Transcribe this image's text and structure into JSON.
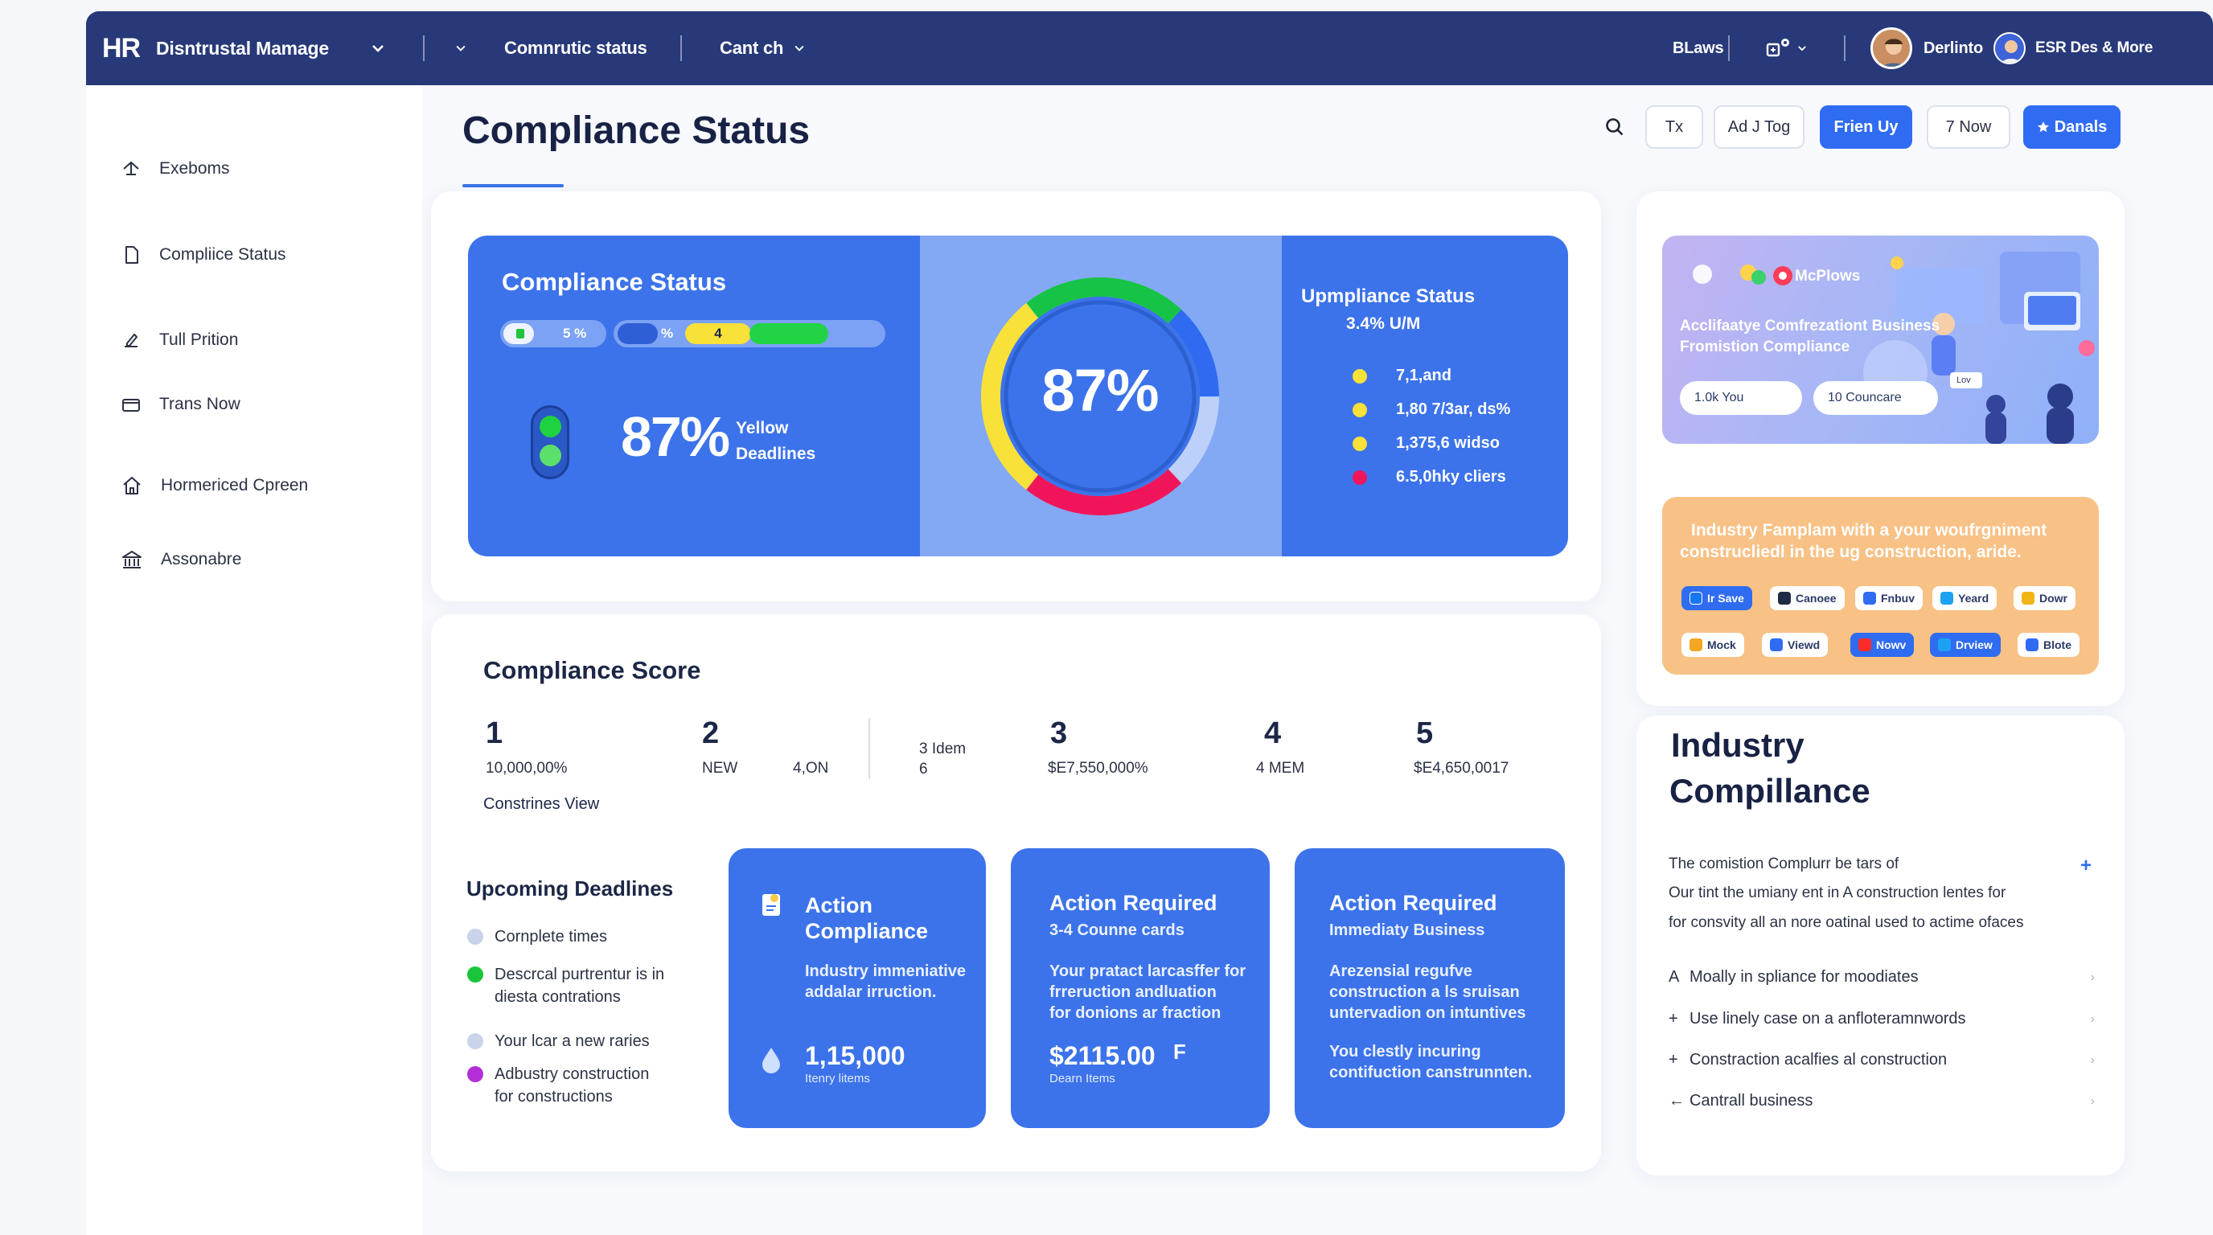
{
  "topbar": {
    "logo": "HR",
    "app_name": "Disntrustal Mamage",
    "nav1": "Comnrutic status",
    "nav2": "Cant ch",
    "blaws": "BLaws",
    "user1": "Derlinto",
    "user2": "ESR Des & More"
  },
  "sidebar": {
    "items": [
      {
        "label": "Exeboms",
        "icon": "upload-icon"
      },
      {
        "label": "Compliice Status",
        "icon": "document-icon"
      },
      {
        "label": "Tull Prition",
        "icon": "edit-icon"
      },
      {
        "label": "Trans Now",
        "icon": "folder-icon"
      },
      {
        "label": "Hormericed Cpreen",
        "icon": "home-icon"
      },
      {
        "label": "Assonabre",
        "icon": "bank-icon"
      }
    ]
  },
  "header": {
    "title": "Compliance Status",
    "buttons": [
      "Tx",
      "Ad J Tog",
      "Frien Uy",
      "7 Now",
      "Danals"
    ]
  },
  "hero": {
    "left_title": "Compliance Status",
    "pill1": "5 %",
    "pill2a": "%",
    "pill2b": "4",
    "big_pct": "87%",
    "big_label1": "Yellow",
    "big_label2": "Deadlines",
    "donut_value": "87%",
    "donut_fraction": 0.87,
    "right_title": "Upmpliance Status",
    "right_sub": "3.4% U/M",
    "legend": [
      {
        "label": "7,1,and",
        "color": "#f8e139"
      },
      {
        "label": "1,80 7/3ar, ds%",
        "color": "#f8e139"
      },
      {
        "label": "1,375,6 widso",
        "color": "#f8e139"
      },
      {
        "label": "6.5,0hky cliers",
        "color": "#f0155b"
      }
    ]
  },
  "score": {
    "title": "Compliance Score",
    "cols": [
      {
        "num": "1",
        "sub": "10,000,00%"
      },
      {
        "num": "2",
        "sub": "NEW"
      },
      {
        "num": "",
        "sub": "4,ON"
      },
      {
        "num": "3",
        "sub": "$E7,550,000%"
      },
      {
        "num": "4",
        "sub": "4 MEM"
      },
      {
        "num": "5",
        "sub": "$E4,650,0017"
      }
    ],
    "mid_label1": "3 Idem",
    "mid_label2": "6",
    "link": "Constrines View"
  },
  "deadlines": {
    "title": "Upcoming Deadlines",
    "items": [
      {
        "text": "Cornplete times",
        "color": "#c9d3ea"
      },
      {
        "text": "Descrcal purtrentur is in\ndiesta contrations",
        "color": "#19c53a"
      },
      {
        "text": "Your lcar a new raries",
        "color": "#c9d3ea"
      },
      {
        "text": "Adbustry construction\nfor constructions",
        "color": "#b42ed8"
      }
    ]
  },
  "actions": [
    {
      "title": "Action\nCompliance",
      "body": "Industry immeniative\naddalar irruction.",
      "value": "1,15,000",
      "value_sub": "Itenry litems"
    },
    {
      "title": "Action Required",
      "subtitle": "3-4 Counne cards",
      "body": "Your pratact larcasffer for\nfrreruction andluation\nfor donions ar fraction",
      "value": "$2115.00",
      "value_sub": "Dearn Items",
      "suffix": "F"
    },
    {
      "title": "Action Required",
      "subtitle": "Immediaty Business",
      "body": "Arezensial regufve\nconstruction a ls sruisan\nuntervadion on intuntives",
      "body2": "You clestly incuring\ncontifuction canstrunnten."
    }
  ],
  "promo": {
    "brand": "McPlows",
    "text1": "Acclifaatye Comfrezationt Business",
    "text2": "Fromistion Compliance",
    "pill1": "1.0k You",
    "pill2": "10 Councare",
    "tag": "Lov"
  },
  "orange": {
    "text1": "Industry Famplam with a your woufrgniment",
    "text2": "construcliedl in the ug construction, aride.",
    "chips_row1": [
      {
        "label": "Ir Save",
        "style": "blue",
        "icon_color": "#1877f2"
      },
      {
        "label": "Canoee",
        "style": "white",
        "icon_color": "#1f2a44"
      },
      {
        "label": "Fnbuv",
        "style": "white",
        "icon_color": "#2f6cf2"
      },
      {
        "label": "Yeard",
        "style": "white",
        "icon_color": "#1da1f2"
      },
      {
        "label": "Dowr",
        "style": "white",
        "icon_color": "#f2b418"
      }
    ],
    "chips_row2": [
      {
        "label": "Mock",
        "style": "white",
        "icon_color": "#f5a623"
      },
      {
        "label": "Viewd",
        "style": "white",
        "icon_color": "#2f6cf2"
      },
      {
        "label": "Nowv",
        "style": "blue",
        "icon_color": "#ff2b2b"
      },
      {
        "label": "Drview",
        "style": "blue",
        "icon_color": "#1da1f2"
      },
      {
        "label": "Blote",
        "style": "white",
        "icon_color": "#2f6cf2"
      }
    ]
  },
  "industry": {
    "title1": "Industry",
    "title2": "Compillance",
    "p1": "The comistion Complurr be tars of",
    "p2": "Our tint the umiany ent in A construction lentes for",
    "p3": "for consvity all an nore oatinal used to actime ofaces",
    "items": [
      {
        "prefix": "A",
        "text": "Moally in spliance for moodiates"
      },
      {
        "prefix": "+",
        "text": "Use linely case on a anfloteramnwords"
      },
      {
        "prefix": "+",
        "text": "Constraction acalfies al construction"
      },
      {
        "prefix": "←",
        "text": "Cantrall business"
      }
    ]
  }
}
